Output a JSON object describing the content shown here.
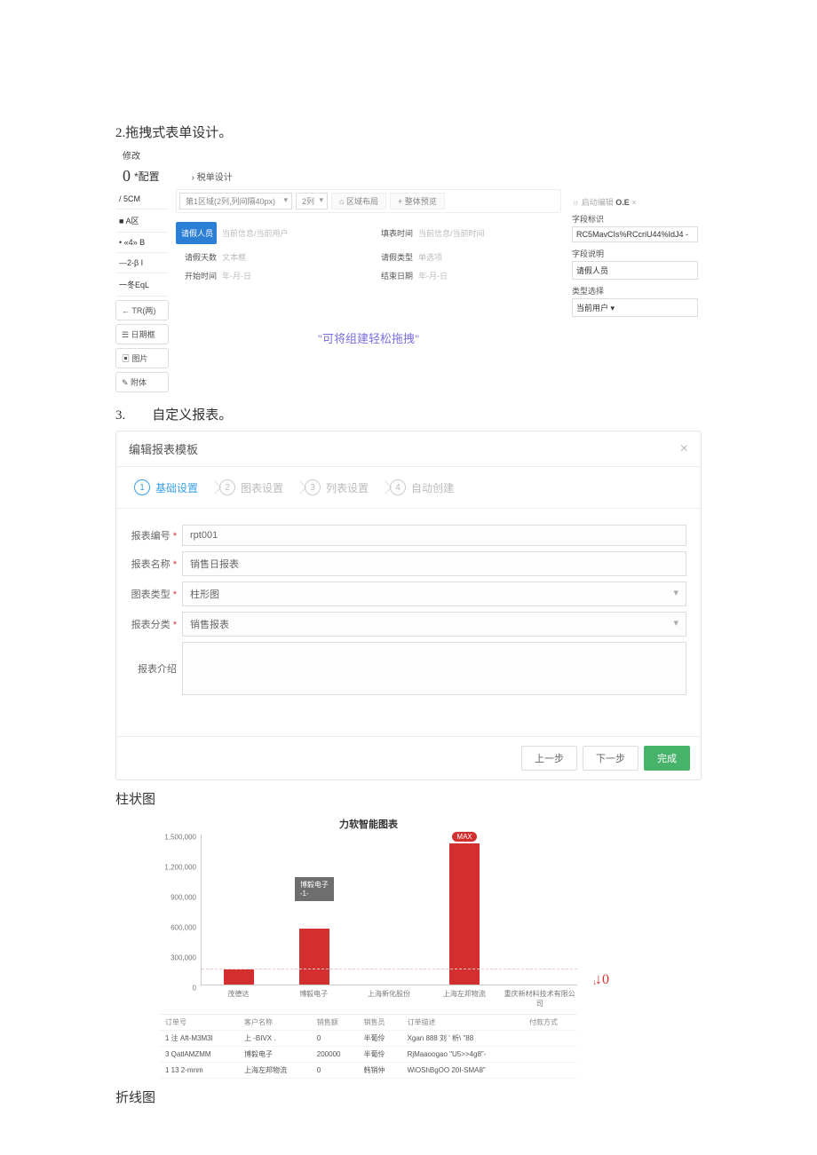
{
  "section2_title": "2.拖拽式表单设计。",
  "section3_title": "3.        自定义报表。",
  "form_designer": {
    "top_small_label": "修改",
    "config_prefix": "0",
    "config_label": "*配置",
    "page_label": "› 税单设计",
    "left_static_rows": [
      "/ 5CM",
      "■ A区",
      "• «4» B",
      "—2-β I",
      "一冬EqL"
    ],
    "left_buttons": [
      "← TR(两)",
      "☰ 日期框",
      "▣ 图片",
      "✎ 附体"
    ],
    "toolbar_selects": [
      "第1区域(2列,列间隔40px)",
      "2列"
    ],
    "toolbar_buttons": [
      "⌂ 区域布局",
      "+ 整体预览"
    ],
    "form_rows": [
      {
        "l1": "请假人员",
        "v1": "当前信息/当前用户",
        "l2": "填表时间",
        "v2": "当前信息/当前时间",
        "l1_active": true
      },
      {
        "l1": "请假天数",
        "v1": "文本框",
        "l2": "请假类型",
        "v2": "单选项"
      },
      {
        "l1": "开始时间",
        "v1": "年-月-日",
        "l2": "结束日期",
        "v2": "年-月-日"
      }
    ],
    "drop_hint": "\"可将组建轻松拖拽\"",
    "right_header_light": "☼ 启动编辑",
    "right_header_bold": "O.E",
    "right_header_tail": "×",
    "right_items": [
      {
        "label": "字段标识",
        "value": "RC5MavCIs%RCcriU44%IdJ4 -"
      },
      {
        "label": "字段说明",
        "value": "请假人员"
      },
      {
        "label": "类型选择",
        "value": "当前用户 ▾"
      }
    ]
  },
  "report_wizard": {
    "title": "编辑报表模板",
    "steps": [
      "基础设置",
      "图表设置",
      "列表设置",
      "自动创建"
    ],
    "active_step": 0,
    "fields": [
      {
        "label": "报表编号",
        "req": true,
        "value": "rpt001",
        "dropdown": false
      },
      {
        "label": "报表名称",
        "req": true,
        "value": "销售日报表",
        "dropdown": false
      },
      {
        "label": "图表类型",
        "req": true,
        "value": "柱形图",
        "dropdown": true
      },
      {
        "label": "报表分类",
        "req": true,
        "value": "销售报表",
        "dropdown": true
      },
      {
        "label": "报表介绍",
        "req": false,
        "value": "",
        "textarea": true
      }
    ],
    "btn_prev": "上一步",
    "btn_next": "下一步",
    "btn_done": "完成"
  },
  "bar_chart_heading": "柱状图",
  "line_chart_heading": "折线图",
  "chart_data": {
    "type": "bar",
    "title": "力软智能图表",
    "xlabel": "",
    "ylabel": "",
    "ylim": [
      0,
      1500000
    ],
    "y_ticks": [
      0,
      300000,
      600000,
      900000,
      1200000,
      1500000
    ],
    "categories": [
      "茂德达",
      "博毅电子",
      "上海新化股份",
      "上海左邦物流",
      "重庆新材料技术有限公司"
    ],
    "values": [
      150000,
      560000,
      0,
      1400000,
      0
    ],
    "tooltip": {
      "index": 1,
      "text": "博毅电子\n-1-"
    },
    "badge": {
      "index": 3,
      "text": "MAX"
    },
    "baseline_dashed_at": 150000,
    "extra_right_label": "↓0"
  },
  "data_table": {
    "headers": [
      "订单号",
      "客户名称",
      "销售额",
      "销售员",
      "订单描述",
      "付款方式"
    ],
    "rows": [
      [
        "1 注 Aft-M3M3l",
        "上 -BIVX .",
        "0",
        "半葡伶",
        "Xgan 888 刘 ' 析\\ \"88",
        ""
      ],
      [
        "3 QatlAMZMM",
        "博毅电子",
        "200000",
        "半葡伶",
        "RjMaaoogao \"U5>>4g8\"-",
        ""
      ],
      [
        "1 13 2-mnm",
        "上海左邦物流",
        "0",
        "韩销仲",
        "WiOShBgOO 20I-SMA8\"",
        ""
      ]
    ]
  }
}
